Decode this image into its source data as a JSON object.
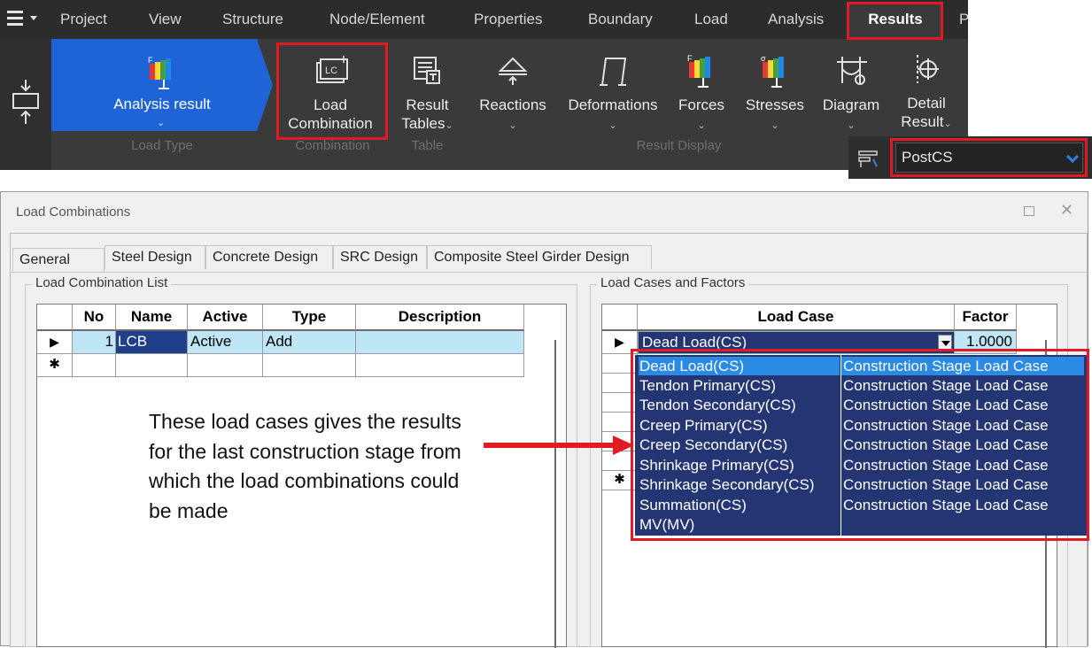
{
  "menu": {
    "items": [
      "Project",
      "View",
      "Structure",
      "Node/Element",
      "Properties",
      "Boundary",
      "Load",
      "Analysis",
      "Results",
      "P"
    ],
    "active": "Results"
  },
  "ribbon": {
    "analysis_result": "Analysis result",
    "load_combination": [
      "Load",
      "Combination"
    ],
    "result_tables": [
      "Result",
      "Tables"
    ],
    "reactions": "Reactions",
    "deformations": "Deformations",
    "forces": "Forces",
    "stresses": "Stresses",
    "diagram": "Diagram",
    "detail_result": [
      "Detail",
      "Result"
    ],
    "groups": {
      "load_type": "Load Type",
      "combination": "Combination",
      "table": "Table",
      "result_display": "Result Display"
    },
    "stage_select": "PostCS",
    "icon_letters": {
      "forces_f": "F",
      "stresses_sigma": "σ",
      "analysis_f": "F",
      "lc": "LC"
    }
  },
  "dialog": {
    "title": "Load Combinations",
    "tabs": [
      "General",
      "Steel Design",
      "Concrete Design",
      "SRC Design",
      "Composite Steel Girder Design"
    ],
    "active_tab": "General",
    "list_group": "Load Combination List",
    "cases_group": "Load Cases and Factors",
    "list_headers": [
      "No",
      "Name",
      "Active",
      "Type",
      "Description"
    ],
    "list_rows": [
      {
        "marker": "▶",
        "no": "1",
        "name": "LCB",
        "active": "Active",
        "type": "Add",
        "description": ""
      },
      {
        "marker": "✱",
        "no": "",
        "name": "",
        "active": "",
        "type": "",
        "description": ""
      }
    ],
    "cases_headers": [
      "Load Case",
      "Factor"
    ],
    "cases_current": {
      "marker": "▶",
      "load_case": "Dead Load(CS)",
      "factor": "1.0000"
    },
    "cases_new_marker": "✱",
    "dropdown": [
      {
        "name": "Dead Load(CS)",
        "type": "Construction Stage Load Case"
      },
      {
        "name": "Tendon Primary(CS)",
        "type": "Construction Stage Load Case"
      },
      {
        "name": "Tendon Secondary(CS)",
        "type": "Construction Stage Load Case"
      },
      {
        "name": "Creep Primary(CS)",
        "type": "Construction Stage Load Case"
      },
      {
        "name": "Creep Secondary(CS)",
        "type": "Construction Stage Load Case"
      },
      {
        "name": "Shrinkage Primary(CS)",
        "type": "Construction Stage Load Case"
      },
      {
        "name": "Shrinkage Secondary(CS)",
        "type": "Construction Stage Load Case"
      },
      {
        "name": "Summation(CS)",
        "type": "Construction Stage Load Case"
      },
      {
        "name": "MV(MV)",
        "type": ""
      }
    ]
  },
  "annotation": "These load cases gives the results for the last construction stage from which the load combinations could be made",
  "colors": {
    "highlight": "#e11b24",
    "ribbon_bg": "#3a3a3a",
    "analysis_blue": "#1f64d6",
    "dropdown_bg": "#243573",
    "dropdown_selected": "#2a8ae4",
    "row_selected": "#bfe6f7"
  }
}
